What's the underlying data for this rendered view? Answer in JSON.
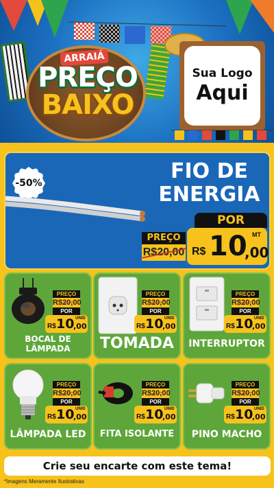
{
  "header": {
    "badge_top": "ARRAIÁ",
    "title_line1": "PREÇO",
    "title_line2": "BAIXO",
    "logo_placeholder_line1": "Sua Logo",
    "logo_placeholder_line2": "Aqui"
  },
  "featured": {
    "discount": "-50%",
    "title_line1": "FIO DE",
    "title_line2": "ENERGIA",
    "por_label": "POR",
    "preco_label": "PREÇO",
    "old_price": "R$20,00",
    "currency": "R$",
    "price_int": "10",
    "price_dec": ",00",
    "unit": "MT"
  },
  "products": [
    {
      "name": "BOCAL DE LÂMPADA",
      "preco_label": "PREÇO",
      "old_price": "R$20,00",
      "por_label": "POR",
      "currency": "R$",
      "price_int": "10",
      "price_dec": ",00",
      "unit": "UNID"
    },
    {
      "name": "TOMADA",
      "preco_label": "PREÇO",
      "old_price": "R$20,00",
      "por_label": "POR",
      "currency": "R$",
      "price_int": "10",
      "price_dec": ",00",
      "unit": "UNID"
    },
    {
      "name": "INTERRUPTOR",
      "preco_label": "PREÇO",
      "old_price": "R$20,00",
      "por_label": "POR",
      "currency": "R$",
      "price_int": "10",
      "price_dec": ",00",
      "unit": "UNID"
    },
    {
      "name": "LÂMPADA LED",
      "preco_label": "PREÇO",
      "old_price": "R$20,00",
      "por_label": "POR",
      "currency": "R$",
      "price_int": "10",
      "price_dec": ",00",
      "unit": "UNID"
    },
    {
      "name": "FITA ISOLANTE",
      "preco_label": "PREÇO",
      "old_price": "R$20,00",
      "por_label": "POR",
      "currency": "R$",
      "price_int": "10",
      "price_dec": ",00",
      "unit": "UNID"
    },
    {
      "name": "PINO MACHO",
      "preco_label": "PREÇO",
      "old_price": "R$20,00",
      "por_label": "POR",
      "currency": "R$",
      "price_int": "10",
      "price_dec": ",00",
      "unit": "UNID"
    }
  ],
  "footer": {
    "cta": "Crie seu encarte com este tema!",
    "disclaimer": "*Imagens Meramente Ilustrativas"
  },
  "colors": {
    "background_yellow": "#f6c21b",
    "header_blue": "#1b6fc0",
    "featured_blue": "#1a67b8",
    "card_green": "#5ea63a",
    "price_yellow": "#f7c21c",
    "label_black": "#111111"
  },
  "icons": [
    "fio-cable-icon",
    "bocal-icon",
    "tomada-icon",
    "interruptor-icon",
    "lampada-icon",
    "fita-icon",
    "pino-icon"
  ]
}
